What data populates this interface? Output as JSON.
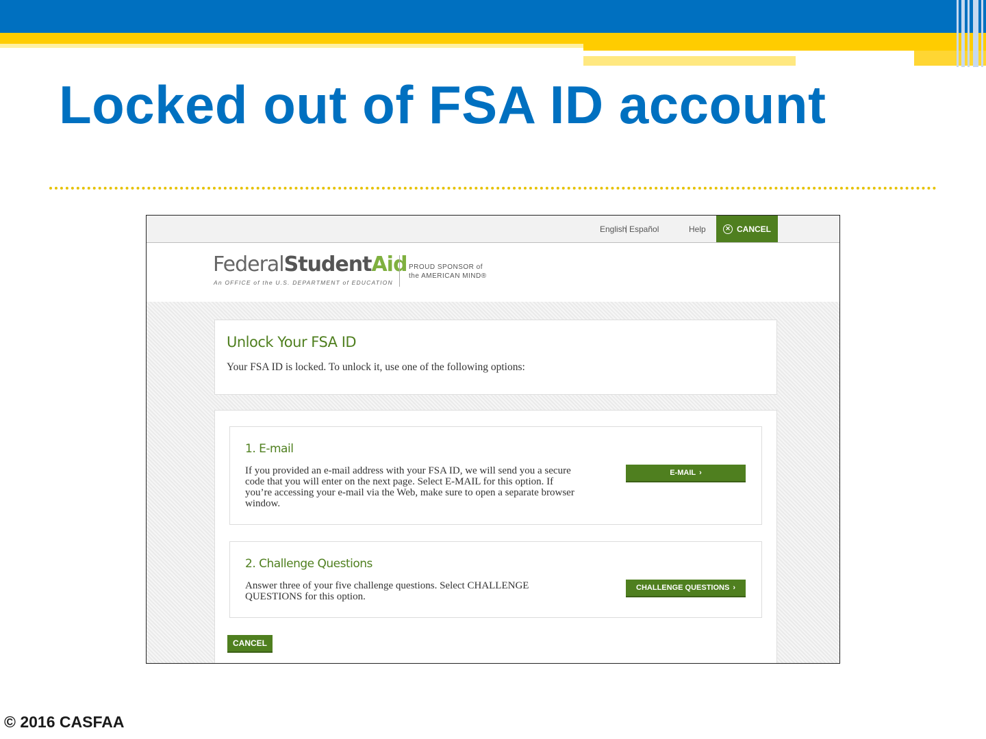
{
  "slide": {
    "title": "Locked out of FSA ID account",
    "footer": "© 2016 CASFAA"
  },
  "topbar": {
    "english": "English",
    "separator": "|",
    "espanol": "Español",
    "help": "Help",
    "cancel": "CANCEL"
  },
  "logo": {
    "federal": "Federal",
    "student": "Student",
    "aid": "Aid",
    "subtitle": "An OFFICE of the U.S. DEPARTMENT of EDUCATION",
    "sponsor_line1": "PROUD SPONSOR of",
    "sponsor_line2": "the AMERICAN MIND®"
  },
  "unlock": {
    "title": "Unlock Your FSA ID",
    "text": "Your FSA ID is locked. To unlock it, use one of the following options:"
  },
  "options": [
    {
      "title": "1. E-mail",
      "text": "If you provided an e-mail address with your FSA ID, we will send you a secure code that you will enter on the next page. Select E-MAIL for this option. If you’re accessing your e-mail via the Web, make sure to open a separate browser window.",
      "button": "E-MAIL"
    },
    {
      "title": "2. Challenge Questions",
      "text": "Answer three of your five challenge questions. Select CHALLENGE QUESTIONS for this option.",
      "button": "CHALLENGE QUESTIONS"
    }
  ],
  "bottom": {
    "cancel": "CANCEL"
  },
  "icons": {
    "chevron": "›",
    "close": "✕"
  },
  "colors": {
    "slide_blue": "#0070c0",
    "slide_yellow": "#ffcc00",
    "fsa_green": "#4f7f1f"
  }
}
